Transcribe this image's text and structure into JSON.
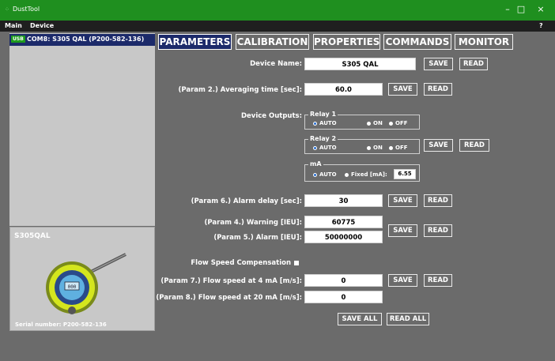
{
  "window": {
    "title": "DustTool",
    "logo": "dusttool-logo",
    "minimize": "–",
    "maximize": "□",
    "close": "×"
  },
  "menu": {
    "main": "Main",
    "device": "Device",
    "help": "?"
  },
  "devices": {
    "usb_badge": "USB",
    "selected": "COM8: S305 QAL (P200-582-136)"
  },
  "device_info": {
    "name": "S305QAL",
    "serial": "Serial number:    P200-582-136"
  },
  "tabs": [
    "PARAMETERS",
    "CALIBRATION",
    "PROPERTIES",
    "COMMANDS",
    "MONITOR"
  ],
  "params": {
    "device_name_label": "Device Name:",
    "device_name_value": "S305 QAL",
    "averaging_label": "(Param 2.) Averaging time [sec]:",
    "averaging_value": "60.0",
    "outputs_label": "Device Outputs:",
    "relay1": {
      "title": "Relay 1",
      "auto": "AUTO",
      "on": "ON",
      "off": "OFF"
    },
    "relay2": {
      "title": "Relay 2",
      "auto": "AUTO",
      "on": "ON",
      "off": "OFF"
    },
    "ma": {
      "title": "mA",
      "auto": "AUTO",
      "fixed": "Fixed [mA]:",
      "fixed_value": "6.55"
    },
    "alarm_delay_label": "(Param 6.) Alarm delay [sec]:",
    "alarm_delay_value": "30",
    "warning_label": "(Param 4.) Warning [IEU]:",
    "warning_value": "60775",
    "alarm_label": "(Param 5.) Alarm [IEU]:",
    "alarm_value": "50000000",
    "flow_comp_label": "Flow Speed Compensation",
    "flow4_label": "(Param 7.) Flow speed at 4 mA [m/s]:",
    "flow4_value": "0",
    "flow20_label": "(Param 8.) Flow speed at 20 mA [m/s]:",
    "flow20_value": "0"
  },
  "buttons": {
    "save": "SAVE",
    "read": "READ",
    "save_all": "SAVE ALL",
    "read_all": "READ ALL"
  },
  "colors": {
    "titlebar": "#1f8f1f",
    "accent": "#1c2a6a",
    "background": "#6b6b6b"
  }
}
